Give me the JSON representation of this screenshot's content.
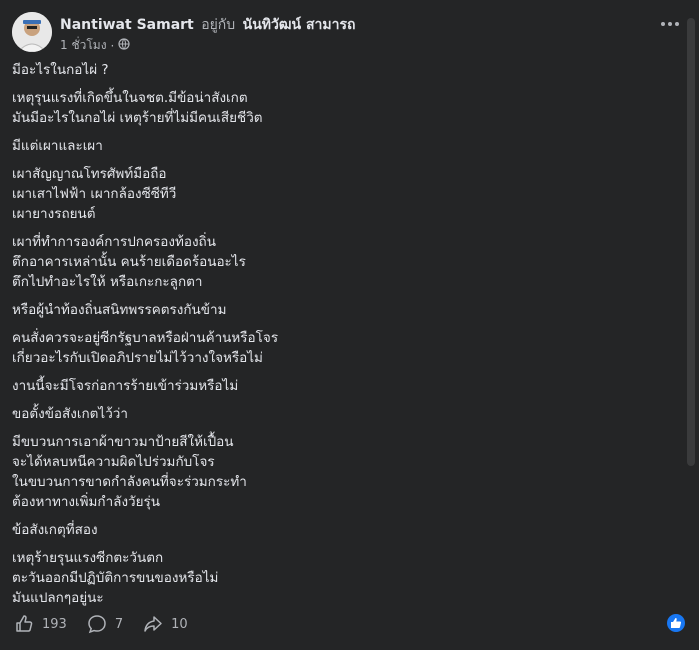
{
  "post": {
    "author": "Nantiwat Samart",
    "with_text": "อยู่กับ",
    "tagged": "นันทิวัฒน์ สามารถ",
    "time": "1 ชั่วโมง",
    "separator": "·",
    "privacy_icon": "globe-icon",
    "paragraphs": [
      [
        "มีอะไรในกอไผ่ ?"
      ],
      [
        "เหตุรุนแรงที่เกิดขึ้นในจชต.มีข้อน่าสังเกต",
        "มันมีอะไรในกอไผ่ เหตุร้ายที่ไม่มีคนเสียชีวิต"
      ],
      [
        "มีแต่เผาและเผา"
      ],
      [
        "เผาสัญญาณโทรศัพท์มือถือ",
        "เผาเสาไฟฟ้า เผากล้องซีซีทีวี",
        "เผายางรถยนต์"
      ],
      [
        "เผาที่ทำการองค์การปกครองท้องถิ่น",
        "ตึกอาคารเหล่านั้น  คนร้ายเดือดร้อนอะไร",
        "ตึกไปทำอะไรให้ หรือเกะกะลูกตา"
      ],
      [
        "หรือผู้นำท้องถิ่นสนิทพรรคตรงกันข้าม"
      ],
      [
        "คนสั่งควรจะอยู่ซีกรัฐบาลหรือฝ่านค้านหรือโจร",
        "เกี่ยวอะไรกับเปิดอภิปรายไม่ไว้วางใจหรือไม่"
      ],
      [
        "งานนี้จะมีโจรก่อการร้ายเข้าร่วมหรือไม่"
      ],
      [
        "ขอตั้งข้อสังเกตไว้ว่า"
      ],
      [
        "มีขบวนการเอาผ้าขาวมาป้ายสีให้เปื้อน",
        "จะได้หลบหนีความผิดไปร่วมกับโจร",
        "ในขบวนการขาดกำลังคนที่จะร่วมกระทำ",
        "ต้องหาทางเพิ่มกำลังวัยรุ่น"
      ],
      [
        "ข้อสังเกตุที่สอง"
      ],
      [
        "เหตุร้ายรุนแรงซีกตะวันตก",
        "ตะวันออกมีปฏิบัติการขนของหรือไม่",
        "มันแปลกๆอยู่นะ"
      ]
    ]
  },
  "actions": {
    "likes": "193",
    "comments": "7",
    "shares": "10",
    "like_icon": "thumbs-up-icon",
    "comment_icon": "comment-icon",
    "share_icon": "share-icon"
  },
  "colors": {
    "bg": "#242526",
    "text": "#e4e6eb",
    "secondary": "#b0b3b8",
    "accent": "#1877f2"
  }
}
